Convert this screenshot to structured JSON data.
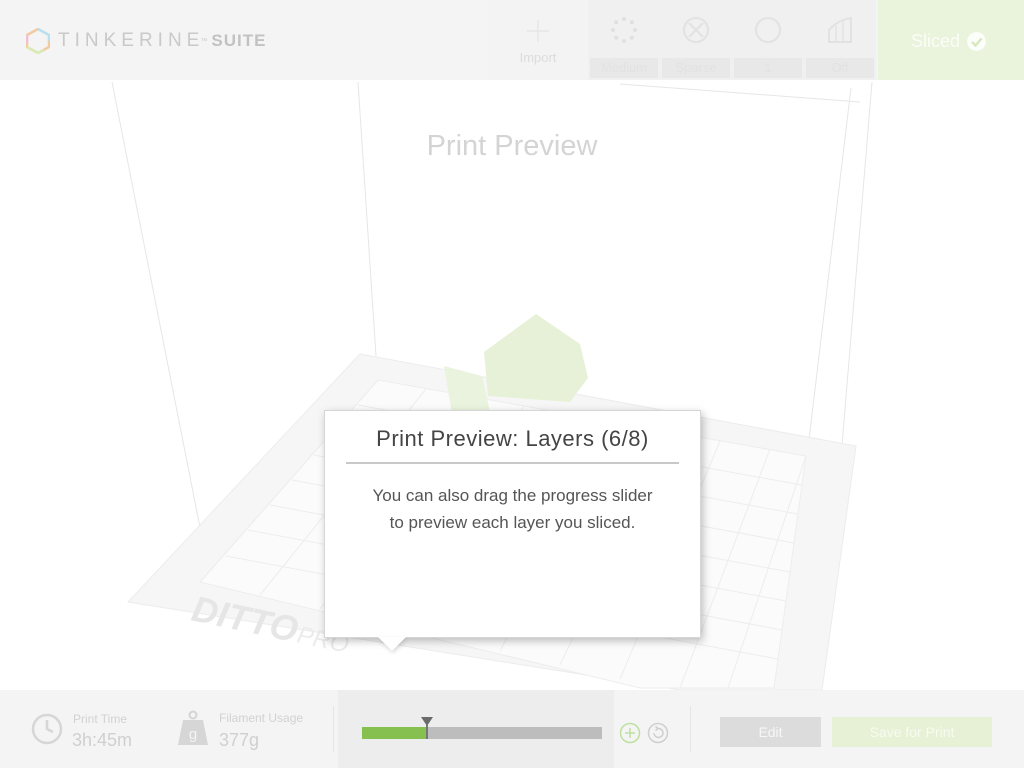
{
  "app": {
    "logo_text": "TINKERINE",
    "logo_tm": "™",
    "logo_suite": "SUITE"
  },
  "toolbar": {
    "import_label": "Import",
    "quality_label": "Medium",
    "infill_label": "Sparse",
    "shells_label": "1",
    "support_label": "Off",
    "sliced_label": "Sliced"
  },
  "viewport": {
    "title": "Print Preview"
  },
  "dialog": {
    "title": "Print Preview: Layers (6/8)",
    "body_line1": "You can also drag the progress slider",
    "body_line2": "to preview each layer you sliced."
  },
  "stats": {
    "print_time_label": "Print Time",
    "print_time_value": "3h:45m",
    "filament_label": "Filament Usage",
    "filament_value": "377g",
    "filament_unit_glyph": "g"
  },
  "slider": {
    "progress_fraction": 0.27
  },
  "buttons": {
    "edit_label": "Edit",
    "save_label": "Save for Print"
  },
  "colors": {
    "accent_green": "#86c050",
    "sliced_bg": "#eaf3dc"
  }
}
